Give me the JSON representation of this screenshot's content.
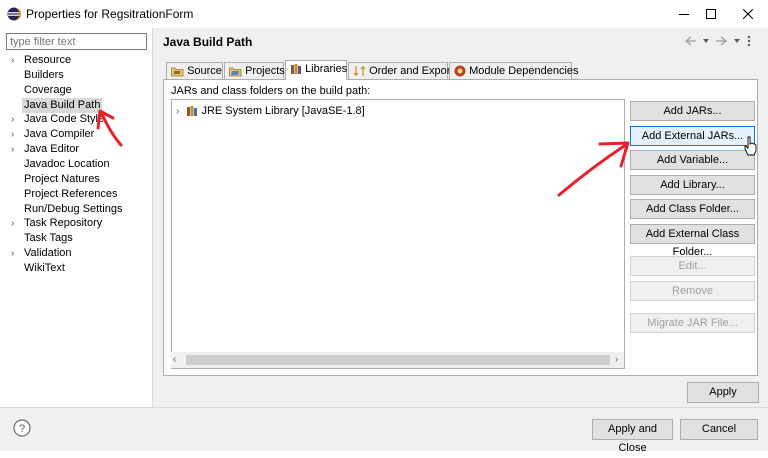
{
  "window": {
    "title": "Properties for RegsitrationForm"
  },
  "filter": {
    "placeholder": "type filter text"
  },
  "tree": [
    {
      "label": "Resource",
      "expandable": true
    },
    {
      "label": "Builders",
      "expandable": false
    },
    {
      "label": "Coverage",
      "expandable": false
    },
    {
      "label": "Java Build Path",
      "expandable": false,
      "selected": true
    },
    {
      "label": "Java Code Style",
      "expandable": true
    },
    {
      "label": "Java Compiler",
      "expandable": true
    },
    {
      "label": "Java Editor",
      "expandable": true
    },
    {
      "label": "Javadoc Location",
      "expandable": false
    },
    {
      "label": "Project Natures",
      "expandable": false
    },
    {
      "label": "Project References",
      "expandable": false
    },
    {
      "label": "Run/Debug Settings",
      "expandable": false
    },
    {
      "label": "Task Repository",
      "expandable": true
    },
    {
      "label": "Task Tags",
      "expandable": false
    },
    {
      "label": "Validation",
      "expandable": true
    },
    {
      "label": "WikiText",
      "expandable": false
    }
  ],
  "page": {
    "title": "Java Build Path"
  },
  "tabs": [
    {
      "label": "Source"
    },
    {
      "label": "Projects"
    },
    {
      "label": "Libraries",
      "active": true
    },
    {
      "label": "Order and Export"
    },
    {
      "label": "Module Dependencies"
    }
  ],
  "libraries": {
    "description": "JARs and class folders on the build path:",
    "entries": [
      {
        "label": "JRE System Library [JavaSE-1.8]"
      }
    ]
  },
  "buttons": {
    "add_jars": "Add JARs...",
    "add_external_jars": "Add External JARs...",
    "add_variable": "Add Variable...",
    "add_library": "Add Library...",
    "add_class_folder": "Add Class Folder...",
    "add_external_class_folder": "Add External Class Folder...",
    "edit": "Edit...",
    "remove": "Remove",
    "migrate_jar": "Migrate JAR File...",
    "apply": "Apply",
    "apply_and_close": "Apply and Close",
    "cancel": "Cancel"
  },
  "colors": {
    "annotation_red": "#e8202a",
    "focus_blue": "#0078d7"
  }
}
